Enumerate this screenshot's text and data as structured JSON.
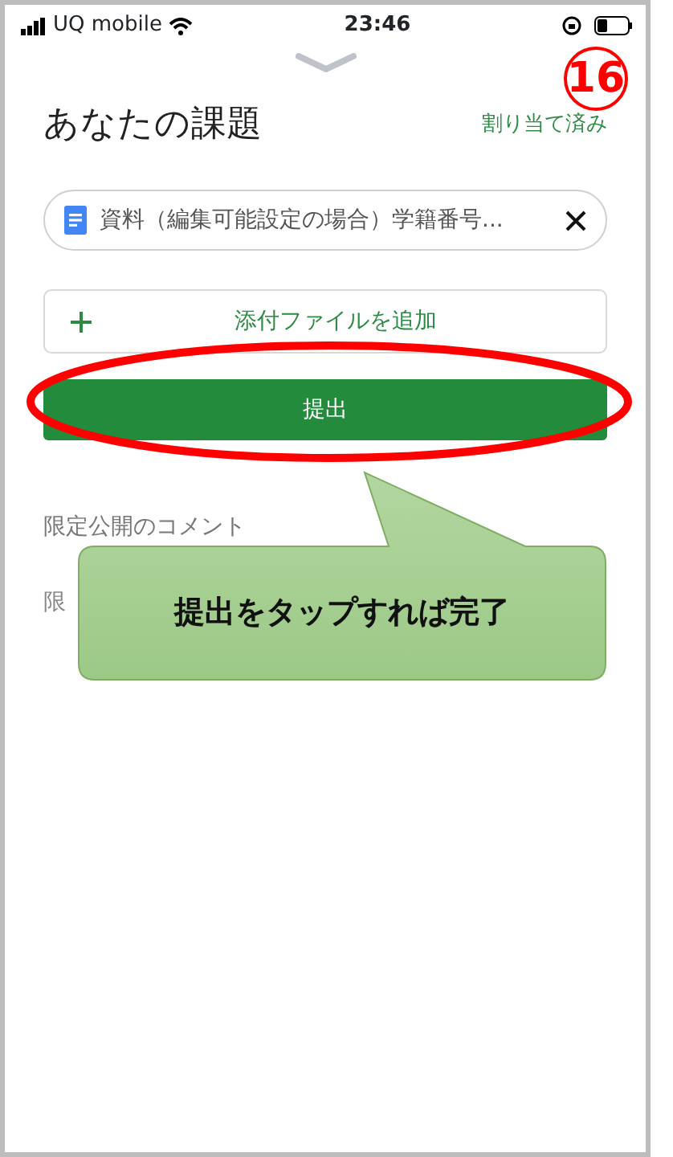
{
  "status_bar": {
    "carrier": "UQ mobile",
    "time": "23:46"
  },
  "header": {
    "title": "あなたの課題",
    "status": "割り当て済み"
  },
  "attachment": {
    "name": "資料（編集可能設定の場合）学籍番号..."
  },
  "add_button": {
    "label": "添付ファイルを追加"
  },
  "submit_button": {
    "label": "提出"
  },
  "comments": {
    "heading": "限定公開のコメント",
    "placeholder": "限"
  },
  "annotations": {
    "step_number": "16",
    "callout": "提出をタップすれば完了"
  }
}
